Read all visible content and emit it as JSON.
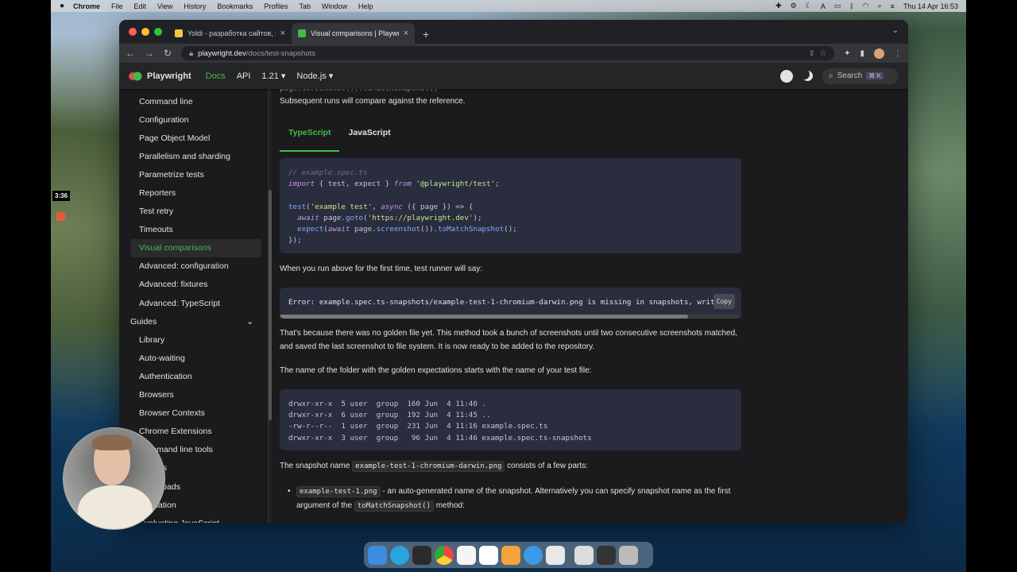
{
  "menubar": {
    "app": "Chrome",
    "items": [
      "File",
      "Edit",
      "View",
      "History",
      "Bookmarks",
      "Profiles",
      "Tab",
      "Window",
      "Help"
    ],
    "clock": "Thu 14 Apr  16:53"
  },
  "browser": {
    "tabs": [
      {
        "title": "Yoldi - разработка сайтов, ма",
        "active": false
      },
      {
        "title": "Visual comparisons | Playwrigh",
        "active": true
      }
    ],
    "url_host": "playwright.dev",
    "url_path": "/docs/test-snapshots"
  },
  "site": {
    "brand": "Playwright",
    "nav": [
      "Docs",
      "API",
      "1.21 ▾",
      "Node.js ▾"
    ],
    "search_placeholder": "Search",
    "search_kbd": "⌘ K"
  },
  "sidebar": {
    "items": [
      {
        "label": "Command line",
        "type": "item"
      },
      {
        "label": "Configuration",
        "type": "item"
      },
      {
        "label": "Page Object Model",
        "type": "item"
      },
      {
        "label": "Parallelism and sharding",
        "type": "item"
      },
      {
        "label": "Parametrize tests",
        "type": "item"
      },
      {
        "label": "Reporters",
        "type": "item"
      },
      {
        "label": "Test retry",
        "type": "item"
      },
      {
        "label": "Timeouts",
        "type": "item"
      },
      {
        "label": "Visual comparisons",
        "type": "active"
      },
      {
        "label": "Advanced: configuration",
        "type": "item"
      },
      {
        "label": "Advanced: fixtures",
        "type": "item"
      },
      {
        "label": "Advanced: TypeScript",
        "type": "item"
      },
      {
        "label": "Guides",
        "type": "cat"
      },
      {
        "label": "Library",
        "type": "item"
      },
      {
        "label": "Auto-waiting",
        "type": "item"
      },
      {
        "label": "Authentication",
        "type": "item"
      },
      {
        "label": "Browsers",
        "type": "item"
      },
      {
        "label": "Browser Contexts",
        "type": "item"
      },
      {
        "label": "Chrome Extensions",
        "type": "item"
      },
      {
        "label": "Command line tools",
        "type": "item"
      },
      {
        "label": "Dialogs",
        "type": "item"
      },
      {
        "label": "Downloads",
        "type": "item"
      },
      {
        "label": "Emulation",
        "type": "item"
      },
      {
        "label": "Evaluating JavaScript",
        "type": "item"
      }
    ]
  },
  "content": {
    "intro_tail": "Subsequent runs will compare against the reference.",
    "tabs": [
      "TypeScript",
      "JavaScript"
    ],
    "code1": [
      [
        {
          "t": "// example.spec.ts",
          "c": "c-com"
        }
      ],
      [
        {
          "t": "import",
          "c": "c-kw"
        },
        {
          "t": " { test, expect } ",
          "c": ""
        },
        {
          "t": "from",
          "c": "c-kw"
        },
        {
          "t": " ",
          "c": ""
        },
        {
          "t": "'@playwright/test'",
          "c": "c-str"
        },
        {
          "t": ";",
          "c": ""
        }
      ],
      [
        {
          "t": " ",
          "c": ""
        }
      ],
      [
        {
          "t": "test",
          "c": "c-fn"
        },
        {
          "t": "(",
          "c": ""
        },
        {
          "t": "'example test'",
          "c": "c-str"
        },
        {
          "t": ", ",
          "c": ""
        },
        {
          "t": "async",
          "c": "c-kw"
        },
        {
          "t": " ({ page }) => {",
          "c": ""
        }
      ],
      [
        {
          "t": "  ",
          "c": ""
        },
        {
          "t": "await",
          "c": "c-kw"
        },
        {
          "t": " page.",
          "c": ""
        },
        {
          "t": "goto",
          "c": "c-fn"
        },
        {
          "t": "(",
          "c": ""
        },
        {
          "t": "'https://playwright.dev'",
          "c": "c-str"
        },
        {
          "t": ");",
          "c": ""
        }
      ],
      [
        {
          "t": "  ",
          "c": ""
        },
        {
          "t": "expect",
          "c": "c-fn"
        },
        {
          "t": "(",
          "c": ""
        },
        {
          "t": "await",
          "c": "c-kw"
        },
        {
          "t": " page.",
          "c": ""
        },
        {
          "t": "screenshot",
          "c": "c-fn"
        },
        {
          "t": "()).",
          "c": ""
        },
        {
          "t": "toMatchSnapshot",
          "c": "c-fn"
        },
        {
          "t": "();",
          "c": ""
        }
      ],
      [
        {
          "t": "});",
          "c": ""
        }
      ]
    ],
    "p_first_run": "When you run above for the first time, test runner will say:",
    "error_line": "Error: example.spec.ts-snapshots/example-test-1-chromium-darwin.png is missing in snapshots, writ",
    "copy_label": "Copy",
    "p_golden": "That's because there was no golden file yet. This method took a bunch of screenshots until two consecutive screenshots matched, and saved the last screenshot to file system. It is now ready to be added to the repository.",
    "p_folder": "The name of the folder with the golden expectations starts with the name of your test file:",
    "code2": [
      "drwxr-xr-x  5 user  group  160 Jun  4 11:46 .",
      "drwxr-xr-x  6 user  group  192 Jun  4 11:45 ..",
      "-rw-r--r--  1 user  group  231 Jun  4 11:16 example.spec.ts",
      "drwxr-xr-x  3 user  group   96 Jun  4 11:46 example.spec.ts-snapshots"
    ],
    "p_snapshot_pre": "The snapshot name ",
    "p_snapshot_code": "example-test-1-chromium-darwin.png",
    "p_snapshot_post": " consists of a few parts:",
    "bullet_code": "example-test-1.png",
    "bullet_text": " - an auto-generated name of the snapshot. Alternatively you can specify snapshot name as the first argument of the ",
    "bullet_code2": "toMatchSnapshot()",
    "bullet_tail": " method:"
  },
  "recorder": {
    "time": "3:36"
  },
  "colors": {
    "accent": "#45ba4b",
    "code_bg": "#292d3e"
  }
}
